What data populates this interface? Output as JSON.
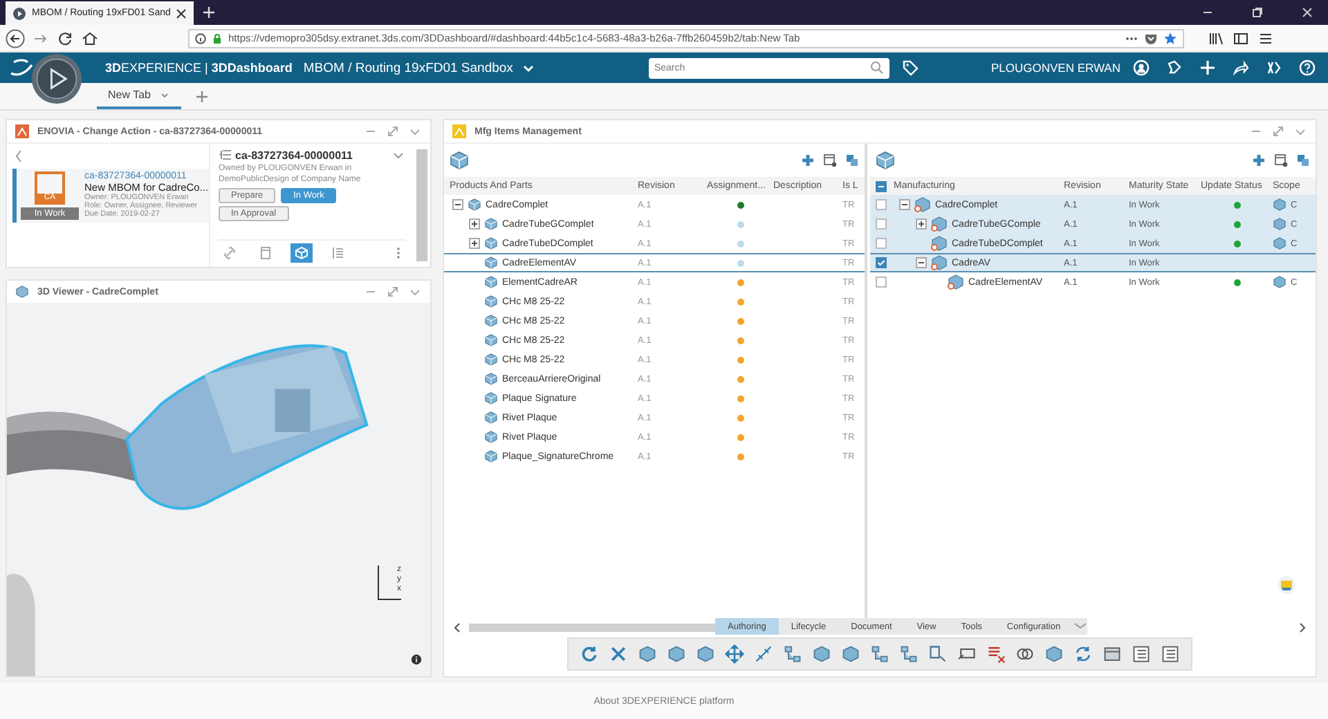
{
  "browser": {
    "tab_title": "MBOM / Routing 19xFD01 Sand",
    "url": "https://vdemopro305dsy.extranet.3ds.com/3DDashboard/#dashboard:44b5c1c4-5683-48a3-b26a-7ffb260459b2/tab:New Tab"
  },
  "header": {
    "brand": "**3D**EXPERIENCE | **3DDashboard**",
    "dashboard": "MBOM / Routing 19xFD01 Sandbox",
    "search": {
      "placeholder": "Search"
    },
    "user": "PLOUGONVEN ERWAN"
  },
  "dashboard_tabs": [
    {
      "label": "New Tab",
      "selected": true
    }
  ],
  "change_action": {
    "title": "ENOVIA - Change Action - ca-83727364-00000011",
    "card": {
      "badge": "CA",
      "status": "In Work",
      "id": "ca-83727364-00000011",
      "name": "New MBOM for CadreCo...",
      "owner": "Owner: PLOUGONVEN Erwan",
      "role": "Role: Owner, Assignee, Reviewer",
      "due": "Due Date: 2019-02-27"
    },
    "detail": {
      "title": "ca-83727364-00000011",
      "owned_by": "Owned by PLOUGONVEN Erwan in DemoPublicDesign of Company Name",
      "states": [
        {
          "label": "Prepare",
          "selected": false
        },
        {
          "label": "In Work",
          "selected": true
        },
        {
          "label": "In Approval",
          "selected": false
        }
      ]
    },
    "actions": [
      {
        "kind": "link",
        "selected": false
      },
      {
        "kind": "document",
        "selected": false
      },
      {
        "kind": "cube",
        "selected": true
      },
      {
        "kind": "list",
        "selected": false
      }
    ]
  },
  "viewer": {
    "title": "3D Viewer - CadreComplet",
    "axes": [
      "z",
      "y",
      "x"
    ]
  },
  "mfg": {
    "title": "Mfg Items Management",
    "left": {
      "columns": [
        "Products And Parts",
        "Revision",
        "Assignment...",
        "Description",
        "Is L"
      ],
      "rows": [
        {
          "name": "CadreComplet",
          "revision": "A.1",
          "color": "#1e7a2e",
          "is_l": "TR",
          "selected": false,
          "expanded": true,
          "children": [
            {
              "name": "CadreTubeGComplet",
              "revision": "A.1",
              "color": "#bcdbe9",
              "is_l": "TR",
              "selected": false,
              "expanded": false
            },
            {
              "name": "CadreTubeDComplet",
              "revision": "A.1",
              "color": "#bcdbe9",
              "is_l": "TR",
              "selected": false,
              "expanded": false
            },
            {
              "name": "CadreElementAV",
              "revision": "A.1",
              "color": "#bcdbe9",
              "is_l": "TR",
              "selected": true
            },
            {
              "name": "ElementCadreAR",
              "revision": "A.1",
              "color": "#f4a52c",
              "is_l": "TR",
              "selected": false
            },
            {
              "name": "CHc M8 25-22",
              "revision": "A.1",
              "color": "#f4a52c",
              "is_l": "TR",
              "selected": false
            },
            {
              "name": "CHc M8 25-22",
              "revision": "A.1",
              "color": "#f4a52c",
              "is_l": "TR",
              "selected": false
            },
            {
              "name": "CHc M8 25-22",
              "revision": "A.1",
              "color": "#f4a52c",
              "is_l": "TR",
              "selected": false
            },
            {
              "name": "CHc M8 25-22",
              "revision": "A.1",
              "color": "#f4a52c",
              "is_l": "TR",
              "selected": false
            },
            {
              "name": "BerceauArriereOriginal",
              "revision": "A.1",
              "color": "#f4a52c",
              "is_l": "TR",
              "selected": false
            },
            {
              "name": "Plaque Signature",
              "revision": "A.1",
              "color": "#f4a52c",
              "is_l": "TR",
              "selected": false
            },
            {
              "name": "Rivet Plaque",
              "revision": "A.1",
              "color": "#f4a52c",
              "is_l": "TR",
              "selected": false
            },
            {
              "name": "Rivet Plaque",
              "revision": "A.1",
              "color": "#f4a52c",
              "is_l": "TR",
              "selected": false
            },
            {
              "name": "Plaque_SignatureChrome",
              "revision": "A.1",
              "color": "#f4a52c",
              "is_l": "TR",
              "selected": false
            }
          ]
        }
      ]
    },
    "right": {
      "select_all": {
        "partial": true
      },
      "columns": [
        "Manufacturing",
        "Revision",
        "Maturity State",
        "Update Status",
        "Scope"
      ],
      "rows": [
        {
          "name": "CadreComplet",
          "revision": "A.1",
          "maturity": "In Work",
          "updated": true,
          "scope": "C",
          "checked": false,
          "highlighted": true,
          "selected": false,
          "expanded": true,
          "children": [
            {
              "name": "CadreTubeGComple",
              "revision": "A.1",
              "maturity": "In Work",
              "updated": true,
              "scope": "C",
              "checked": false,
              "highlighted": true,
              "selected": false,
              "expanded": false
            },
            {
              "name": "CadreTubeDComplet",
              "revision": "A.1",
              "maturity": "In Work",
              "updated": true,
              "scope": "C",
              "checked": false,
              "highlighted": true,
              "selected": false
            },
            {
              "name": "CadreAV",
              "revision": "A.1",
              "maturity": "In Work",
              "updated": false,
              "checked": true,
              "highlighted": true,
              "selected": true,
              "expanded": true,
              "children": [
                {
                  "name": "CadreElementAV",
                  "revision": "A.1",
                  "maturity": "In Work",
                  "updated": true,
                  "scope": "C",
                  "checked": false,
                  "highlighted": false,
                  "selected": false
                }
              ]
            }
          ]
        }
      ]
    },
    "command_tabs": [
      {
        "label": "Authoring",
        "selected": true
      },
      {
        "label": "Lifecycle",
        "selected": false
      },
      {
        "label": "Document",
        "selected": false
      },
      {
        "label": "View",
        "selected": false
      },
      {
        "label": "Tools",
        "selected": false
      },
      {
        "label": "Configuration",
        "selected": false
      }
    ]
  },
  "footer": "About 3DEXPERIENCE platform"
}
